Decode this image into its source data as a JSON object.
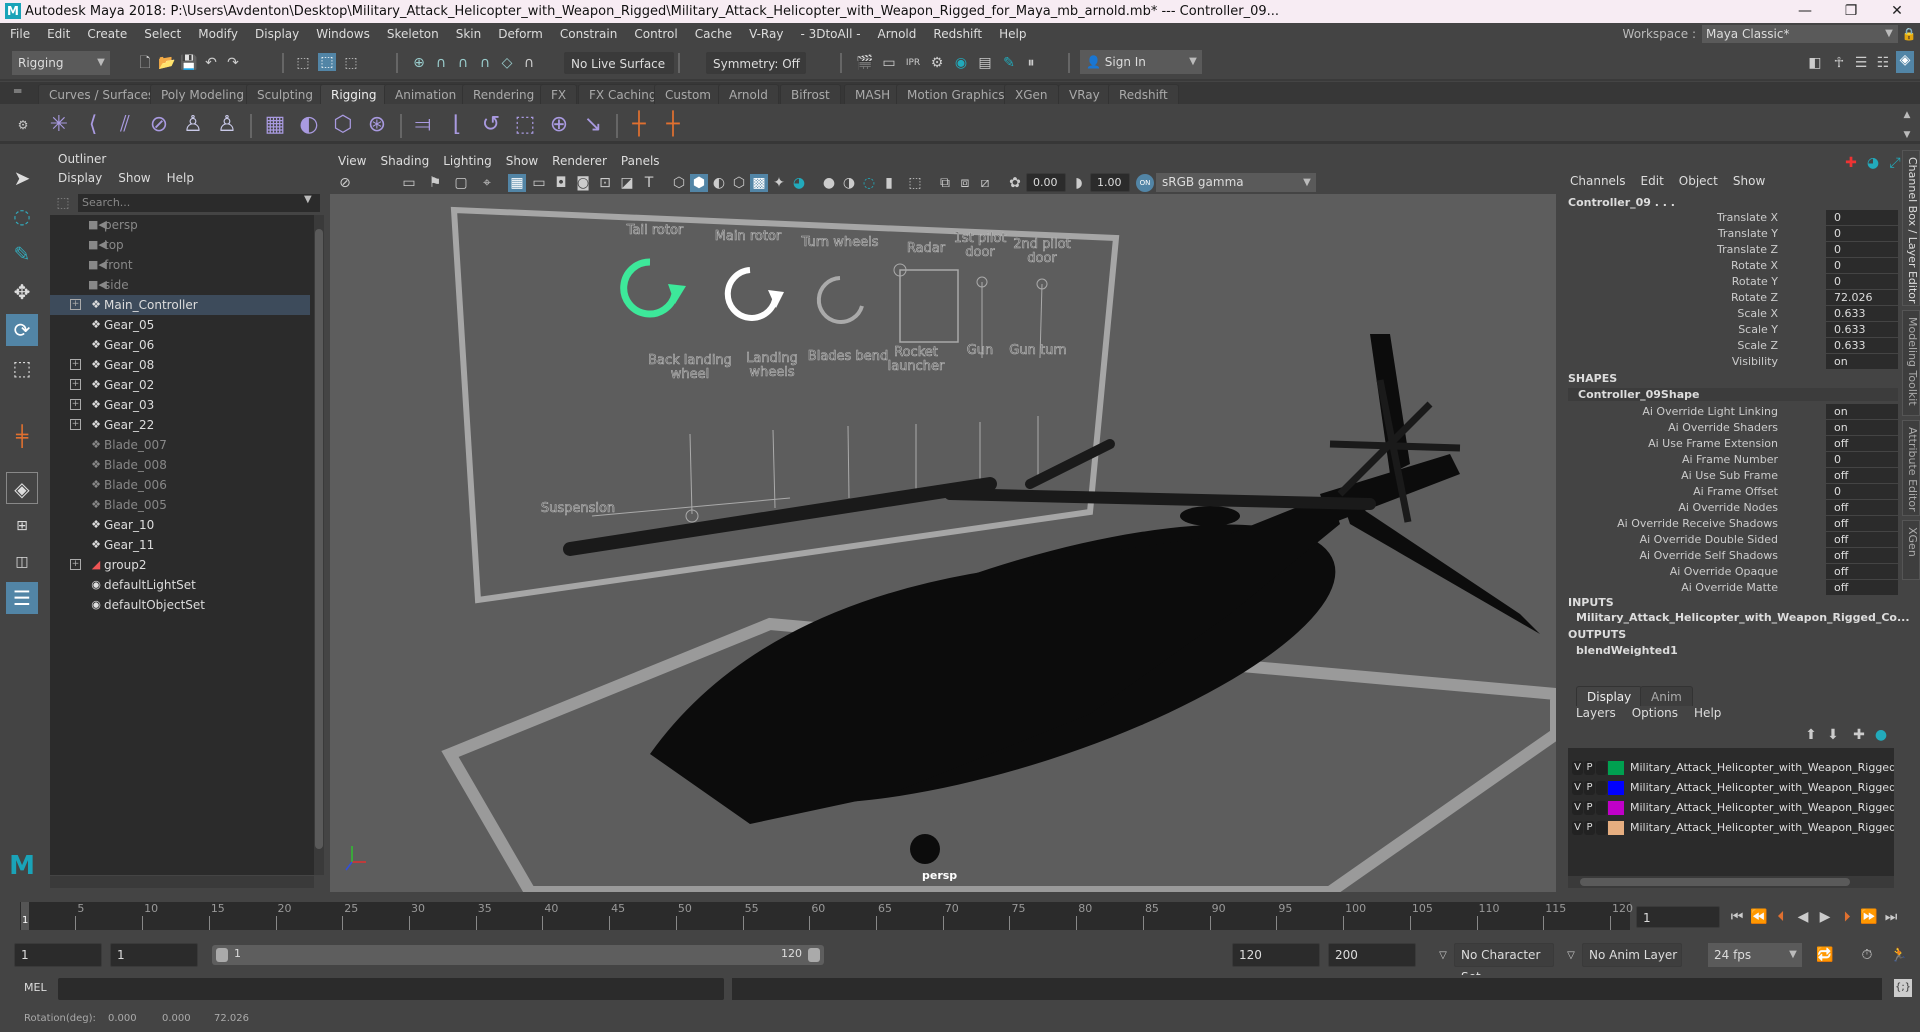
{
  "window": {
    "title": "Autodesk Maya 2018: P:\\Users\\Avdenton\\Desktop\\Military_Attack_Helicopter_with_Weapon_Rigged\\Military_Attack_Helicopter_with_Weapon_Rigged_for_Maya_mb_arnold.mb*   ---   Controller_09...",
    "logo": "M",
    "minimize": "—",
    "restore": "❐",
    "close": "✕"
  },
  "menubar": [
    "File",
    "Edit",
    "Create",
    "Select",
    "Modify",
    "Display",
    "Windows",
    "Skeleton",
    "Skin",
    "Deform",
    "Constrain",
    "Control",
    "Cache",
    "V-Ray",
    "- 3DtoAll -",
    "Arnold",
    "Redshift",
    "Help"
  ],
  "workspace": {
    "label": "Workspace :",
    "value": "Maya Classic*"
  },
  "statusline": {
    "menuset": "Rigging",
    "live_surface": "No Live Surface",
    "symmetry": "Symmetry: Off",
    "sign_in": "Sign In"
  },
  "shelf_tabs": [
    "Curves / Surfaces",
    "Poly Modeling",
    "Sculpting",
    "Rigging",
    "Animation",
    "Rendering",
    "FX",
    "FX Caching",
    "Custom",
    "Arnold",
    "Bifrost",
    "MASH",
    "Motion Graphics",
    "XGen",
    "VRay",
    "Redshift"
  ],
  "active_shelf_tab": "Rigging",
  "shelf_icons": [
    "joint-tool",
    "ik-handle",
    "ik-spline",
    "bind-skin",
    "humanik",
    "quick-rig",
    "paint-weights",
    "smooth-bind",
    "lattice",
    "cluster",
    "parent-constraint",
    "point-constraint",
    "orient-constraint",
    "scale-constraint",
    "aim-constraint",
    "pole-vector-constraint",
    "set-key",
    "set-driven-key"
  ],
  "outliner": {
    "tab": "Outliner",
    "menu": [
      "Display",
      "Show",
      "Help"
    ],
    "search_placeholder": "Search...",
    "items": [
      {
        "label": "persp",
        "type": "camera",
        "dim": true,
        "expand": false
      },
      {
        "label": "top",
        "type": "camera",
        "dim": true,
        "expand": false
      },
      {
        "label": "front",
        "type": "camera",
        "dim": true,
        "expand": false
      },
      {
        "label": "side",
        "type": "camera",
        "dim": true,
        "expand": false
      },
      {
        "label": "Main_Controller",
        "type": "transform",
        "dim": false,
        "expand": true,
        "selected": true
      },
      {
        "label": "Gear_05",
        "type": "transform",
        "dim": false,
        "expand": false
      },
      {
        "label": "Gear_06",
        "type": "transform",
        "dim": false,
        "expand": false
      },
      {
        "label": "Gear_08",
        "type": "transform",
        "dim": false,
        "expand": true
      },
      {
        "label": "Gear_02",
        "type": "transform",
        "dim": false,
        "expand": true
      },
      {
        "label": "Gear_03",
        "type": "transform",
        "dim": false,
        "expand": true
      },
      {
        "label": "Gear_22",
        "type": "transform",
        "dim": false,
        "expand": true
      },
      {
        "label": "Blade_007",
        "type": "transform",
        "dim": true,
        "expand": false
      },
      {
        "label": "Blade_008",
        "type": "transform",
        "dim": true,
        "expand": false
      },
      {
        "label": "Blade_006",
        "type": "transform",
        "dim": true,
        "expand": false
      },
      {
        "label": "Blade_005",
        "type": "transform",
        "dim": true,
        "expand": false
      },
      {
        "label": "Gear_10",
        "type": "transform",
        "dim": false,
        "expand": false
      },
      {
        "label": "Gear_11",
        "type": "transform",
        "dim": false,
        "expand": false
      },
      {
        "label": "group2",
        "type": "group",
        "dim": false,
        "expand": true
      },
      {
        "label": "defaultLightSet",
        "type": "set",
        "dim": false,
        "expand": false
      },
      {
        "label": "defaultObjectSet",
        "type": "set",
        "dim": false,
        "expand": false
      }
    ]
  },
  "viewport": {
    "menu": [
      "View",
      "Shading",
      "Lighting",
      "Show",
      "Renderer",
      "Panels"
    ],
    "exposure": "0.00",
    "gamma": "1.00",
    "color_space": "sRGB gamma",
    "camera_label": "persp",
    "controls_top": [
      "Tail rotor",
      "Main rotor",
      "Turn wheels",
      "Radar",
      "1st pilot door",
      "2nd pilot door"
    ],
    "controls_bottom": [
      "Back landing wheel",
      "Landing wheels",
      "Blades bend",
      "Rocket launcher",
      "Gun",
      "Gun turn"
    ],
    "suspension_label": "Suspension",
    "axis_colors": {
      "x": "#e03030",
      "y": "#30c030",
      "z": "#3050e0"
    },
    "active_control_color": "#3de89a"
  },
  "channelbox": {
    "menu": [
      "Channels",
      "Edit",
      "Object",
      "Show"
    ],
    "object": "Controller_09 . . .",
    "channels": [
      {
        "name": "Translate X",
        "value": "0"
      },
      {
        "name": "Translate Y",
        "value": "0"
      },
      {
        "name": "Translate Z",
        "value": "0"
      },
      {
        "name": "Rotate X",
        "value": "0"
      },
      {
        "name": "Rotate Y",
        "value": "0"
      },
      {
        "name": "Rotate Z",
        "value": "72.026"
      },
      {
        "name": "Scale X",
        "value": "0.633"
      },
      {
        "name": "Scale Y",
        "value": "0.633"
      },
      {
        "name": "Scale Z",
        "value": "0.633"
      },
      {
        "name": "Visibility",
        "value": "on"
      }
    ],
    "shapes_header": "SHAPES",
    "shape_name": "Controller_09Shape",
    "shape_attrs": [
      {
        "name": "Ai Override Light Linking",
        "value": "on"
      },
      {
        "name": "Ai Override Shaders",
        "value": "on"
      },
      {
        "name": "Ai Use Frame Extension",
        "value": "off"
      },
      {
        "name": "Ai Frame Number",
        "value": "0"
      },
      {
        "name": "Ai Use Sub Frame",
        "value": "off"
      },
      {
        "name": "Ai Frame Offset",
        "value": "0"
      },
      {
        "name": "Ai Override Nodes",
        "value": "off"
      },
      {
        "name": "Ai Override Receive Shadows",
        "value": "off"
      },
      {
        "name": "Ai Override Double Sided",
        "value": "off"
      },
      {
        "name": "Ai Override Self Shadows",
        "value": "off"
      },
      {
        "name": "Ai Override Opaque",
        "value": "off"
      },
      {
        "name": "Ai Override Matte",
        "value": "off"
      }
    ],
    "inputs_header": "INPUTS",
    "input": "Military_Attack_Helicopter_with_Weapon_Rigged_Co...",
    "outputs_header": "OUTPUTS",
    "output": "blendWeighted1"
  },
  "side_tabs": [
    "Channel Box / Layer Editor",
    "Modeling Toolkit",
    "Attribute Editor",
    "XGen"
  ],
  "layer_editor": {
    "tabs": [
      "Display",
      "Anim"
    ],
    "menu": [
      "Layers",
      "Options",
      "Help"
    ],
    "layers": [
      {
        "v": "V",
        "p": "P",
        "color": "#00a050",
        "name": "Military_Attack_Helicopter_with_Weapon_Rigged_Body"
      },
      {
        "v": "V",
        "p": "P",
        "color": "#0000ff",
        "name": "Military_Attack_Helicopter_with_Weapon_Rigged_Gear"
      },
      {
        "v": "V",
        "p": "P",
        "color": "#c000c8",
        "name": "Military_Attack_Helicopter_with_Weapon_Rigged_Controller"
      },
      {
        "v": "V",
        "p": "P",
        "color": "#e6ae80",
        "name": "Military_Attack_Helicopter_with_Weapon_Rigged_Helper"
      }
    ]
  },
  "timeslider": {
    "start": 1,
    "end": 120,
    "step": 5,
    "current_frame_marker": "1",
    "current_frame": "1"
  },
  "range": {
    "start": "1",
    "playback_start": "1",
    "range_start": "1",
    "range_end": "120",
    "playback_end": "120",
    "end": "200",
    "character_set": "No Character Set",
    "anim_layer": "No Anim Layer",
    "fps": "24 fps"
  },
  "cmdline": {
    "label": "MEL"
  },
  "helpline": {
    "label": "Rotation(deg):",
    "x": "0.000",
    "y": "0.000",
    "z": "72.026"
  }
}
